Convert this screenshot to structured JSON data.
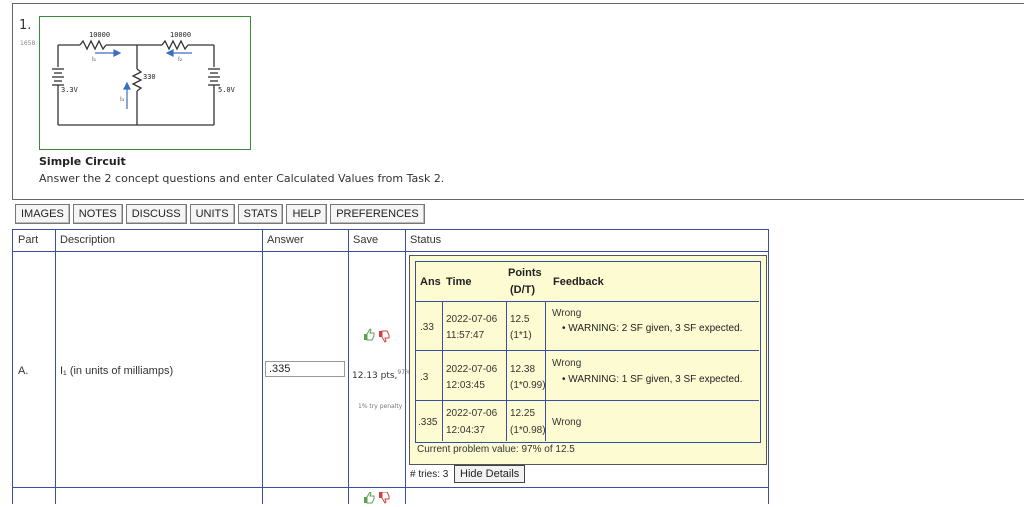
{
  "question": {
    "number": "1.",
    "sub": "1658",
    "title": "Simple Circuit",
    "instructions": "Answer the 2 concept questions and enter Calculated Values from Task 2."
  },
  "circuit": {
    "r_left": "10000",
    "r_right": "10000",
    "r_mid": "330",
    "v_left": "3.3V",
    "v_right": "5.0V",
    "i1": "I₁",
    "i2": "I₂",
    "i3": "I₃"
  },
  "tabs": [
    "IMAGES",
    "NOTES",
    "DISCUSS",
    "UNITS",
    "STATS",
    "HELP",
    "PREFERENCES"
  ],
  "table": {
    "headers": {
      "part": "Part",
      "description": "Description",
      "answer": "Answer",
      "save": "Save",
      "status": "Status"
    },
    "row": {
      "part": "A.",
      "description": "I₁ (in units of milliamps)",
      "answer_value": ".335",
      "score": "12.13 pts,",
      "score_sup": "97%",
      "penalty": "1% try penalty"
    }
  },
  "status": {
    "headers": {
      "ans": "Ans",
      "time": "Time",
      "points": "Points",
      "points_sub": "(D/T)",
      "feedback": "Feedback"
    },
    "attempts": [
      {
        "ans": ".33",
        "date": "2022-07-06",
        "time": "11:57:47",
        "points": "12.5",
        "dt": "(1*1)",
        "result": "Wrong",
        "warning": "WARNING: 2 SF given, 3 SF expected."
      },
      {
        "ans": ".3",
        "date": "2022-07-06",
        "time": "12:03:45",
        "points": "12.38",
        "dt": "(1*0.99)",
        "result": "Wrong",
        "warning": "WARNING: 1 SF given, 3 SF expected."
      },
      {
        "ans": ".335",
        "date": "2022-07-06",
        "time": "12:04:37",
        "points": "12.25",
        "dt": "(1*0.98)",
        "result": "Wrong",
        "warning": ""
      }
    ],
    "current_value": "Current problem value: 97% of 12.5",
    "tries": "# tries: 3",
    "hide_details": "Hide Details"
  }
}
